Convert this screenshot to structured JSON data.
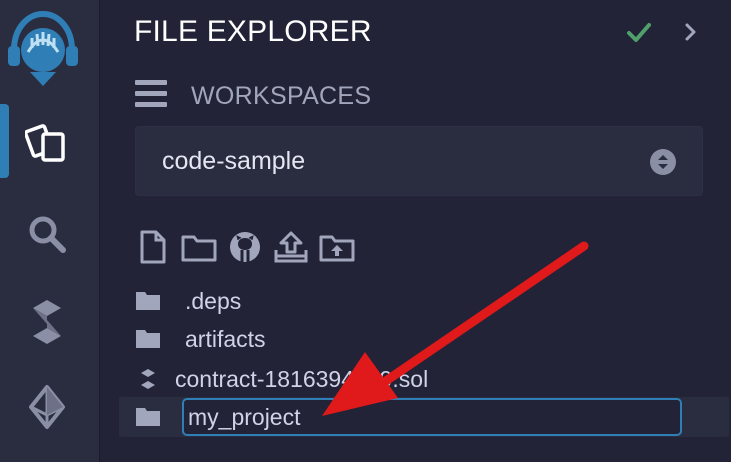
{
  "rail": {
    "items": [
      {
        "name": "file-explorer",
        "icon": "files-icon",
        "active": true
      },
      {
        "name": "search",
        "icon": "search-icon",
        "active": false
      },
      {
        "name": "solidity-compiler",
        "icon": "solidity-icon",
        "active": false
      },
      {
        "name": "deploy-run",
        "icon": "ethereum-icon",
        "active": false
      }
    ]
  },
  "header": {
    "title": "FILE EXPLORER",
    "status_icon": "check-icon",
    "collapse_icon": "chevron-right-icon"
  },
  "workspaces": {
    "menu_icon": "hamburger-icon",
    "label": "WORKSPACES",
    "selected": "code-sample"
  },
  "toolbar": {
    "icons": [
      "new-file-icon",
      "new-folder-icon",
      "github-icon",
      "upload-icon",
      "upload-folder-icon"
    ]
  },
  "tree": {
    "items": [
      {
        "label": ".deps",
        "type": "folder"
      },
      {
        "label": "artifacts",
        "type": "folder"
      },
      {
        "label": "contract-1816394059.sol",
        "type": "solidity-file"
      },
      {
        "label": "my_project",
        "type": "folder",
        "editing": true
      }
    ]
  },
  "colors": {
    "accent": "#2f7eb6",
    "background": "#222336",
    "rail": "#2a2c3f",
    "success": "#4fa06b",
    "annotation_arrow": "#e0191b"
  }
}
